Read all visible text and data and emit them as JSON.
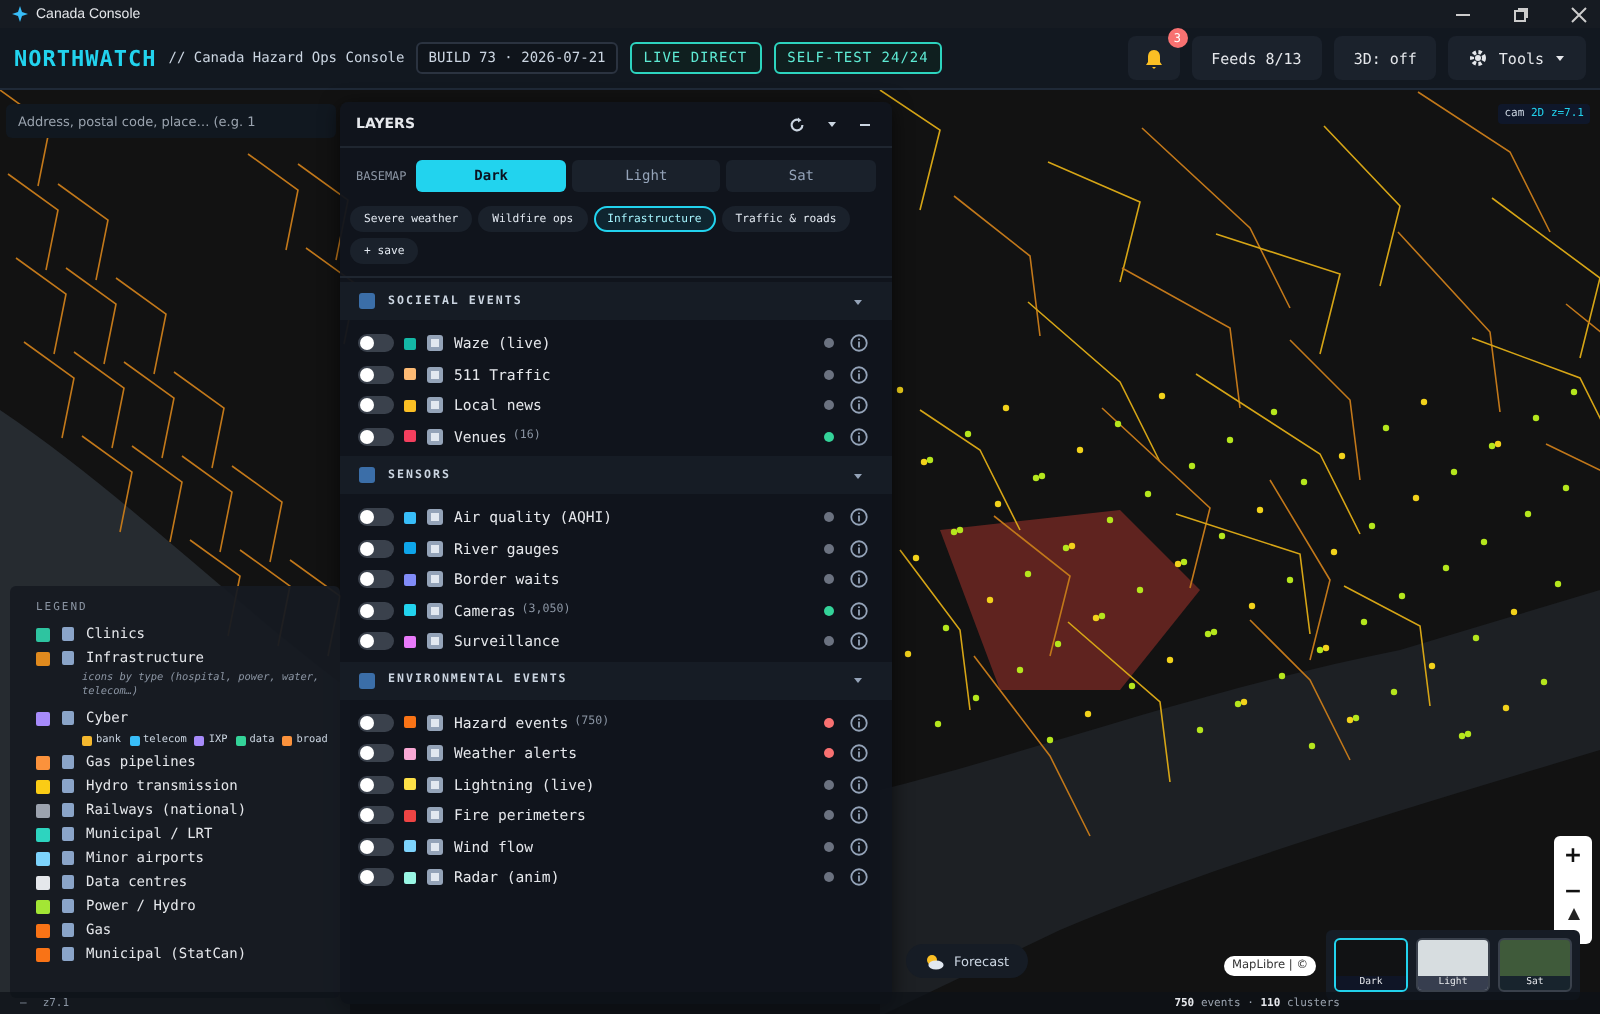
{
  "window": {
    "title": "Canada Console"
  },
  "header": {
    "brand": "NORTHWATCH",
    "subtitle": "// Canada Hazard Ops Console",
    "build": "BUILD 73 · 2026-07-21",
    "live": "LIVE DIRECT",
    "selftest": "SELF-TEST 24/24",
    "notifications": "3",
    "feeds": "Feeds 8/13",
    "mode3d": "3D: off",
    "tools": "Tools"
  },
  "search": {
    "placeholder": "Address, postal code, place… (e.g. 1"
  },
  "camera": {
    "mode": "cam",
    "view": "2D",
    "zoom": "z=7.1"
  },
  "layers": {
    "title": "LAYERS",
    "basemap_label": "BASEMAP",
    "basemaps": [
      {
        "label": "Dark",
        "selected": true
      },
      {
        "label": "Light",
        "selected": false
      },
      {
        "label": "Sat",
        "selected": false
      }
    ],
    "presets": [
      {
        "label": "Severe weather",
        "selected": false
      },
      {
        "label": "Wildfire ops",
        "selected": false
      },
      {
        "label": "Infrastructure",
        "selected": true
      },
      {
        "label": "Traffic & roads",
        "selected": false
      },
      {
        "label": "+ save",
        "selected": false
      }
    ],
    "sections": [
      {
        "title": "SOCIETAL EVENTS",
        "expanded": true,
        "items": [
          {
            "name": "Waze (live)",
            "on": false,
            "color": "#14b8a6",
            "status": {
              "color": "#6b7280"
            }
          },
          {
            "name": "511 Traffic",
            "on": false,
            "color": "#fdba74",
            "status": {
              "color": "#6b7280"
            }
          },
          {
            "name": "Local news",
            "on": false,
            "color": "#fbbf24",
            "status": {
              "color": "#6b7280"
            }
          },
          {
            "name": "Venues",
            "count": "(16)",
            "on": false,
            "color": "#f43f5e",
            "status": {
              "color": "#34d399"
            }
          }
        ]
      },
      {
        "title": "SENSORS",
        "expanded": true,
        "items": [
          {
            "name": "Air quality (AQHI)",
            "on": false,
            "color": "#38bdf8",
            "status": {
              "color": "#6b7280"
            }
          },
          {
            "name": "River gauges",
            "on": false,
            "color": "#0ea5e9",
            "status": {
              "color": "#6b7280"
            }
          },
          {
            "name": "Border waits",
            "on": false,
            "color": "#818cf8",
            "status": {
              "color": "#6b7280"
            }
          },
          {
            "name": "Cameras",
            "count": "(3,050)",
            "on": false,
            "color": "#22d3ee",
            "status": {
              "color": "#34d399"
            }
          },
          {
            "name": "Surveillance",
            "on": false,
            "color": "#e879f9",
            "status": {
              "color": "#6b7280"
            }
          }
        ]
      },
      {
        "title": "ENVIRONMENTAL EVENTS",
        "expanded": true,
        "items": [
          {
            "name": "Hazard events",
            "count": "(750)",
            "on": false,
            "color": "#f97316",
            "status": {
              "color": "#f87171"
            }
          },
          {
            "name": "Weather alerts",
            "on": false,
            "color": "#f9a8d4",
            "status": {
              "color": "#f87171"
            }
          },
          {
            "name": "Lightning (live)",
            "on": false,
            "color": "#fde047",
            "status": {
              "color": "#6b7280"
            }
          },
          {
            "name": "Fire perimeters",
            "on": false,
            "color": "#ef4444",
            "status": {
              "color": "#6b7280"
            }
          },
          {
            "name": "Wind flow",
            "on": false,
            "color": "#7dd3fc",
            "status": {
              "color": "#6b7280"
            }
          },
          {
            "name": "Radar (anim)",
            "on": false,
            "color": "#99f6e4",
            "status": {
              "color": "#6b7280"
            }
          }
        ]
      }
    ]
  },
  "legend": {
    "title": "LEGEND",
    "entries": [
      {
        "kind": "item",
        "label": "Clinics",
        "color": "#2ec4a0"
      },
      {
        "kind": "item",
        "label": "Infrastructure",
        "color": "#e08a1e"
      },
      {
        "kind": "note",
        "label": "icons by type (hospital, power, water, telecom…)"
      },
      {
        "kind": "item",
        "label": "Cyber",
        "color": "#a78bfa"
      },
      {
        "kind": "chips",
        "chips": [
          {
            "label": "bank",
            "color": "#f5b82e"
          },
          {
            "label": "telecom",
            "color": "#38bdf8"
          },
          {
            "label": "IXP",
            "color": "#a78bfa"
          },
          {
            "label": "data",
            "color": "#34d399"
          },
          {
            "label": "broad",
            "color": "#fb923c"
          }
        ]
      },
      {
        "kind": "item",
        "label": "Gas pipelines",
        "color": "#fb923c"
      },
      {
        "kind": "item",
        "label": "Hydro transmission",
        "color": "#facc15"
      },
      {
        "kind": "item",
        "label": "Railways (national)",
        "color": "#9ca3af"
      },
      {
        "kind": "item",
        "label": "Municipal / LRT",
        "color": "#2dd4bf"
      },
      {
        "kind": "item",
        "label": "Minor airports",
        "color": "#7dd3fc"
      },
      {
        "kind": "item",
        "label": "Data centres",
        "color": "#e5e7eb"
      },
      {
        "kind": "item",
        "label": "Power / Hydro",
        "color": "#a3e635"
      },
      {
        "kind": "item",
        "label": "Gas",
        "color": "#f97316"
      },
      {
        "kind": "item",
        "label": "Municipal (StatCan)",
        "color": "#f97316"
      }
    ]
  },
  "map_controls": {
    "zoom_in": "+",
    "zoom_out": "−",
    "forecast": "Forecast",
    "attribution": "MapLibre | ©",
    "thumbnails": [
      {
        "label": "Dark",
        "selected": true
      },
      {
        "label": "Light",
        "selected": false
      },
      {
        "label": "Sat",
        "selected": false
      }
    ]
  },
  "status_bar": {
    "zoom_toggle": "–",
    "zoom": "z7.1",
    "events": "750",
    "events_label": "events ·",
    "clusters": "110",
    "clusters_label": "clusters"
  }
}
